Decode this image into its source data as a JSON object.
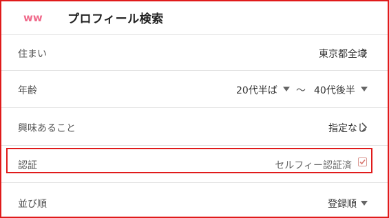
{
  "header": {
    "logo_text": "ww",
    "title": "プロフィール検索"
  },
  "rows": {
    "residence": {
      "label": "住まい",
      "value": "東京都全域"
    },
    "age": {
      "label": "年齢",
      "min": "20代半ば",
      "separator": "〜",
      "max": "40代後半"
    },
    "interest": {
      "label": "興味あること",
      "value": "指定なし"
    },
    "verification": {
      "label": "認証",
      "value": "セルフィー認証済",
      "checked": true
    },
    "sort": {
      "label": "並び順",
      "value": "登録順"
    }
  },
  "colors": {
    "brand_pink": "#f06a8b",
    "highlight_red": "#e01b1b",
    "checkbox_red": "#d9776f"
  },
  "icons": {
    "chevron": "chevron-right-icon",
    "dropdown": "triangle-down-icon",
    "check": "checkmark-icon"
  }
}
